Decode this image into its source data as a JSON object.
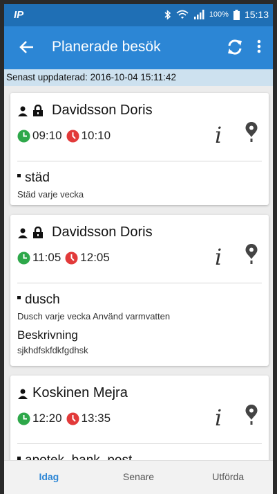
{
  "status": {
    "carrier": "IP",
    "battery": "100%",
    "time": "15:13"
  },
  "appbar": {
    "title": "Planerade besök"
  },
  "updated": "Senast uppdaterad: 2016-10-04 15:11:42",
  "visits": [
    {
      "name": "Davidsson Doris",
      "start": "09:10",
      "end": "10:10",
      "task": "städ",
      "task_desc": "Städ varje vecka"
    },
    {
      "name": "Davidsson Doris",
      "start": "11:05",
      "end": "12:05",
      "task": "dusch",
      "task_desc": "Dusch varje vecka Använd varmvatten",
      "desc_label": "Beskrivning",
      "desc_text": "sjkhdfskfdkfgdhsk"
    },
    {
      "name": "Koskinen Mejra",
      "start": "12:20",
      "end": "13:35",
      "task": "apotek, bank, post"
    }
  ],
  "info_glyph": "i",
  "tabs": {
    "today": "Idag",
    "later": "Senare",
    "done": "Utförda"
  },
  "colors": {
    "appbar": "#2c86d5",
    "statusbar": "#1f6fb5",
    "start": "#2ea84a",
    "end": "#e23a3a"
  }
}
